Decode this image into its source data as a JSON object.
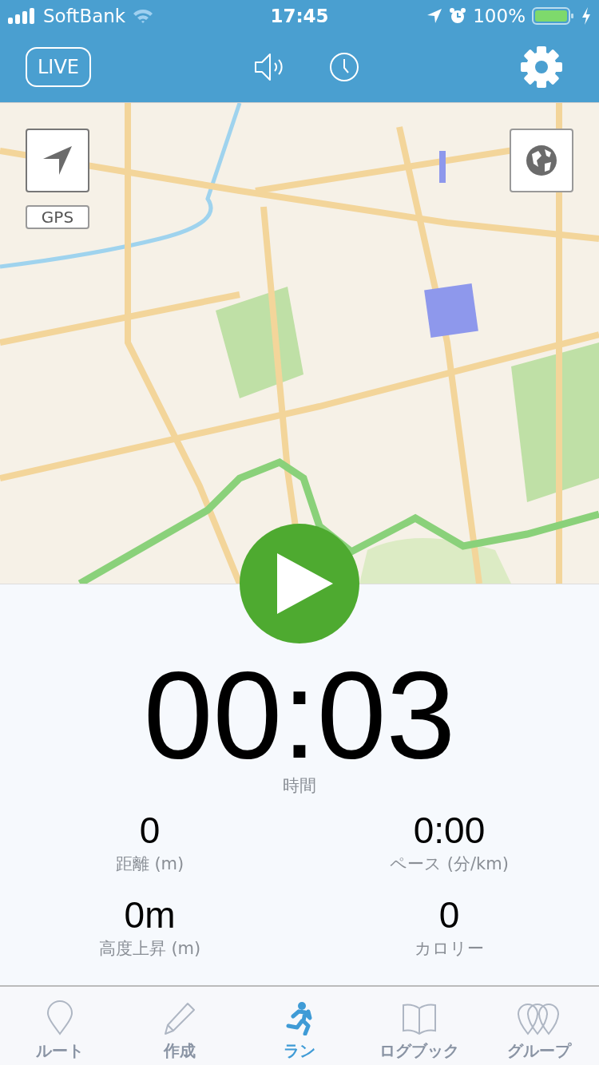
{
  "status_bar": {
    "carrier": "SoftBank",
    "time": "17:45",
    "battery": "100%"
  },
  "header": {
    "live_button": "LIVE"
  },
  "map": {
    "gps_label": "GPS"
  },
  "timer": {
    "value": "00:03",
    "label": "時間"
  },
  "stats": [
    {
      "value": "0",
      "label": "距離 (m)"
    },
    {
      "value": "0:00",
      "label": "ペース (分/km)"
    },
    {
      "value": "0m",
      "label": "高度上昇 (m)"
    },
    {
      "value": "0",
      "label": "カロリー"
    }
  ],
  "tabs": [
    {
      "label": "ルート",
      "kind": "pin",
      "selected": false
    },
    {
      "label": "作成",
      "kind": "pencil",
      "selected": false
    },
    {
      "label": "ラン",
      "kind": "runner",
      "selected": true
    },
    {
      "label": "ログブック",
      "kind": "book",
      "selected": false
    },
    {
      "label": "グループ",
      "kind": "pins",
      "selected": false
    }
  ]
}
